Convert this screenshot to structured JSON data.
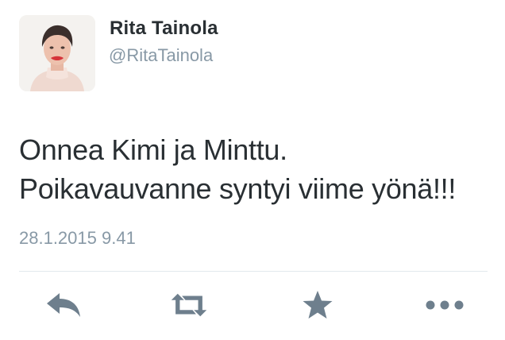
{
  "tweet": {
    "author_name": "Rita Tainola",
    "author_handle": "@RitaTainola",
    "text_line1": "Onnea Kimi ja Minttu.",
    "text_line2": "Poikavauvanne syntyi viime yönä!!!",
    "timestamp": "28.1.2015 9.41"
  },
  "actions": [
    {
      "name": "reply",
      "icon": "reply-icon"
    },
    {
      "name": "retweet",
      "icon": "retweet-icon"
    },
    {
      "name": "favorite",
      "icon": "star-icon"
    },
    {
      "name": "more",
      "icon": "more-dots-icon"
    }
  ],
  "colors": {
    "text": "#292f33",
    "secondary": "#8899a6",
    "icon": "#6e7f8d",
    "divider": "#e1e8ed"
  }
}
